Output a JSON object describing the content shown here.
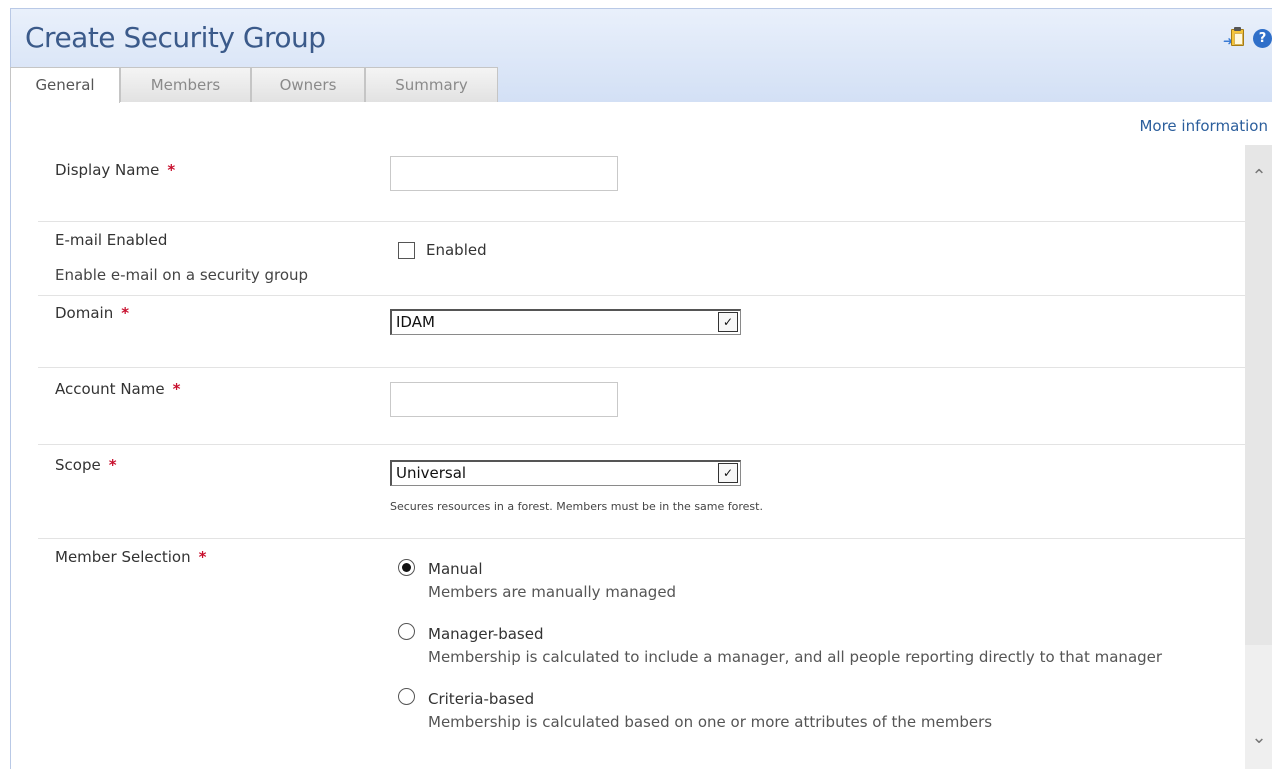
{
  "header": {
    "title": "Create Security Group",
    "icons": [
      "paste-clipboard-icon",
      "help-icon"
    ],
    "help_glyph": "?"
  },
  "tabs": [
    {
      "label": "General",
      "active": true
    },
    {
      "label": "Members",
      "active": false
    },
    {
      "label": "Owners",
      "active": false
    },
    {
      "label": "Summary",
      "active": false
    }
  ],
  "more_information": "More information",
  "form": {
    "display_name": {
      "label": "Display Name",
      "required": "*",
      "value": ""
    },
    "email_enabled": {
      "label": "E-mail Enabled",
      "description": "Enable e-mail on a security group",
      "checkbox_label": "Enabled",
      "checked": false
    },
    "domain": {
      "label": "Domain",
      "required": "*",
      "selected": "IDAM"
    },
    "account_name": {
      "label": "Account Name",
      "required": "*",
      "value": ""
    },
    "scope": {
      "label": "Scope",
      "required": "*",
      "selected": "Universal",
      "help": "Secures resources in a forest. Members must be in the same forest."
    },
    "member_selection": {
      "label": "Member Selection",
      "required": "*",
      "options": [
        {
          "label": "Manual",
          "description": "Members are manually managed",
          "checked": true
        },
        {
          "label": "Manager-based",
          "description": "Membership is calculated to include a manager, and all people reporting directly to that manager",
          "checked": false
        },
        {
          "label": "Criteria-based",
          "description": "Membership is calculated based on one or more attributes of the members",
          "checked": false
        }
      ]
    }
  },
  "colors": {
    "title": "#3b5a8a",
    "header_bg": "#dce6f7",
    "required": "#c8102e",
    "link": "#2b5e9c"
  }
}
